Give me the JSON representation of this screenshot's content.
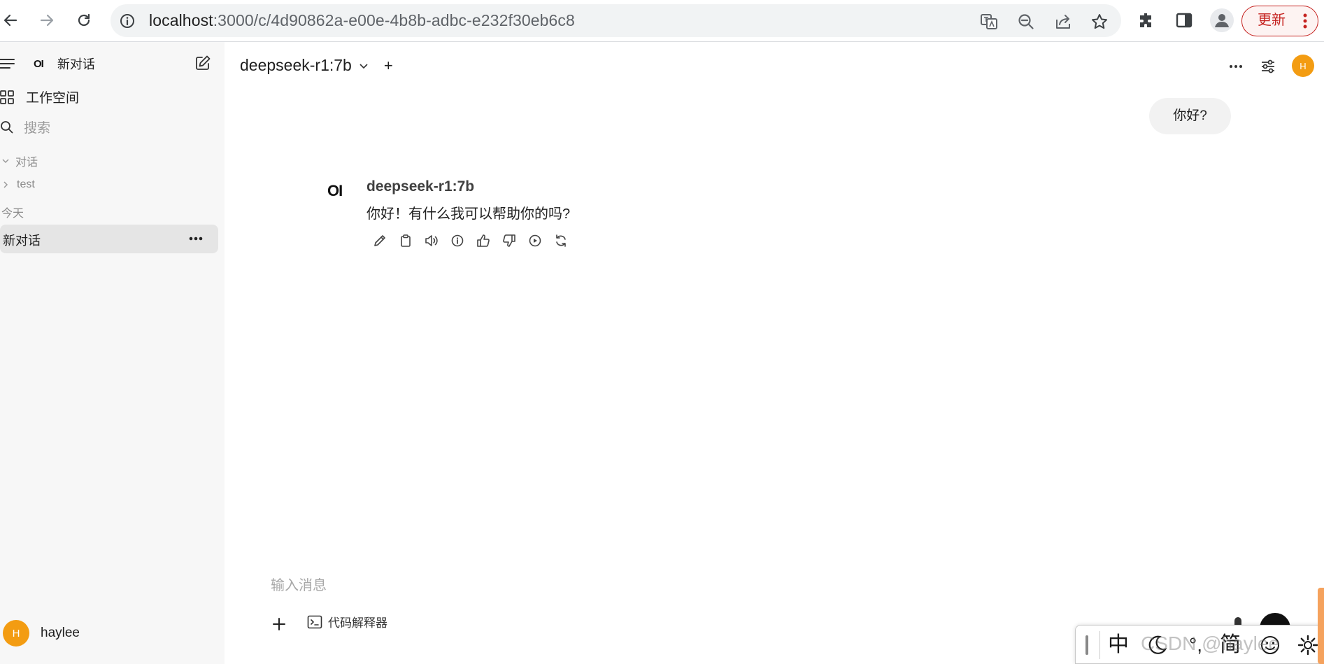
{
  "browser": {
    "url_host": "localhost",
    "url_path": ":3000/c/4d90862a-e00e-4b8b-adbc-e232f30eb6c8",
    "update_label": "更新",
    "icons": [
      "back-icon",
      "forward-icon",
      "reload-icon",
      "site-info-icon",
      "translate-icon",
      "zoom-out-icon",
      "share-icon",
      "bookmark-star-icon",
      "extensions-icon",
      "side-panel-icon",
      "profile-icon",
      "kebab-menu-icon"
    ]
  },
  "sidebar": {
    "new_chat_label": "新对话",
    "logo": "OI",
    "workspace_label": "工作空间",
    "search_placeholder": "搜索",
    "section_chats": "对话",
    "folder_test": "test",
    "section_today": "今天",
    "active_chat_label": "新对话",
    "user": {
      "name": "haylee",
      "initial": "H",
      "avatar_color": "#f39c12"
    }
  },
  "header": {
    "model_name": "deepseek-r1:7b",
    "add_model": "+",
    "avatar_initial": "H"
  },
  "conversation": {
    "user_message": "你好?",
    "assistant": {
      "logo": "OI",
      "model_name": "deepseek-r1:7b",
      "message": "你好！有什么我可以帮助你的吗?",
      "actions": [
        "edit-icon",
        "copy-icon",
        "read-aloud-icon",
        "info-icon",
        "thumbs-up-icon",
        "thumbs-down-icon",
        "continue-icon",
        "regenerate-icon"
      ]
    }
  },
  "composer": {
    "placeholder": "输入消息",
    "code_interpreter_label": "代码解释器"
  },
  "ime_toolbar": {
    "mode": "中",
    "punct": "°,",
    "script": "简",
    "watermark": "CSDN @haylee"
  }
}
